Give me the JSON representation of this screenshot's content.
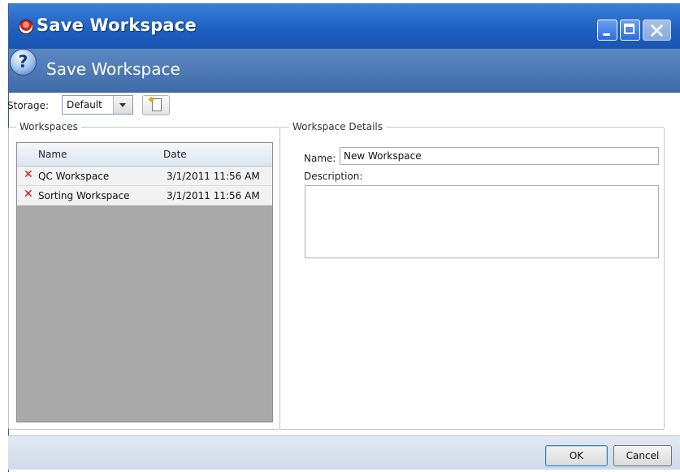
{
  "window": {
    "title": "Save Workspace"
  },
  "header": {
    "title": "Save Workspace",
    "help_icon": "question-mark-icon",
    "help_glyph": "?"
  },
  "storage": {
    "label": "Storage:",
    "value": "Default",
    "new_icon": "new-document-icon"
  },
  "workspaces": {
    "legend": "Workspaces",
    "columns": {
      "name": "Name",
      "date": "Date"
    },
    "rows": [
      {
        "name": "QC Workspace",
        "date": "3/1/2011 11:56 AM",
        "delete_icon": "delete-x-icon",
        "delete_glyph": "✕"
      },
      {
        "name": "Sorting Workspace",
        "date": "3/1/2011 11:56 AM",
        "delete_icon": "delete-x-icon",
        "delete_glyph": "✕"
      }
    ]
  },
  "details": {
    "legend": "Workspace Details",
    "name_label": "Name:",
    "name_value": "New Workspace",
    "description_label": "Description:",
    "description_value": ""
  },
  "buttons": {
    "ok": "OK",
    "cancel": "Cancel"
  },
  "colors": {
    "titlebar": "#1d5fc0",
    "header_band": "#4f7cb8",
    "delete_red": "#cc1111",
    "list_background": "#a9a9a9"
  }
}
